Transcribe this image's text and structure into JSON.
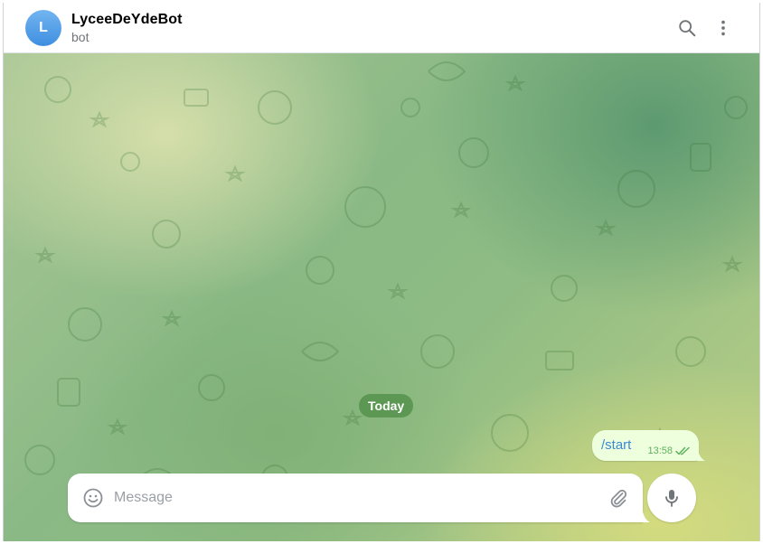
{
  "header": {
    "avatar_letter": "L",
    "title": "LyceeDeYdeBot",
    "status": "bot",
    "icons": [
      "search-icon",
      "more-vertical-icon"
    ]
  },
  "chat": {
    "date_separator": "Today",
    "messages": [
      {
        "direction": "outgoing",
        "text": "/start",
        "time": "13:58",
        "status": "read"
      }
    ]
  },
  "composer": {
    "placeholder": "Message",
    "value": "",
    "icons": [
      "emoji-icon",
      "attach-icon",
      "microphone-icon"
    ]
  },
  "colors": {
    "accent": "#3a8ad1",
    "outgoing_bubble": "#eeffde",
    "check_green": "#5fb05e",
    "date_chip": "#4e8c46"
  }
}
